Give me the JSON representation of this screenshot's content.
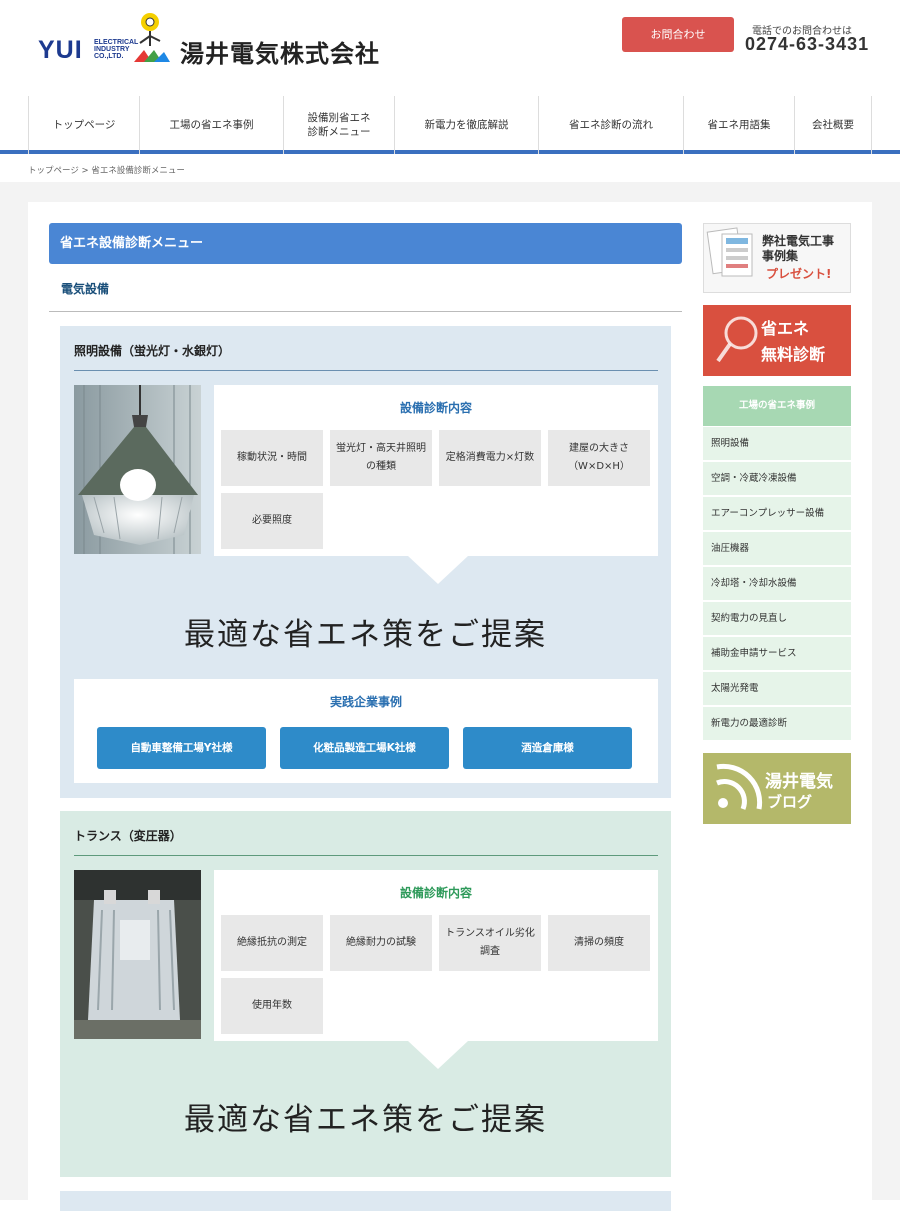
{
  "header": {
    "logo_text": "YUI",
    "logo_sub": "ELECTRICAL INDUSTRY CO.,LTD.",
    "company_name": "湯井電気株式会社",
    "contact_button": "お問合わせ",
    "tel_label": "電話でのお問合わせは",
    "tel_number": "0274-63-3431"
  },
  "nav": {
    "items": [
      {
        "label": "トップページ"
      },
      {
        "label": "工場の省エネ事例"
      },
      {
        "label": "設備別省エネ\n診断メニュー"
      },
      {
        "label": "新電力を徹底解説"
      },
      {
        "label": "省エネ診断の流れ"
      },
      {
        "label": "省エネ用語集"
      },
      {
        "label": "会社概要"
      }
    ]
  },
  "breadcrumb": {
    "home": "トップページ",
    "sep": ">",
    "current": "省エネ設備診断メニュー"
  },
  "main": {
    "title": "省エネ設備診断メニュー",
    "subtitle": "電気設備",
    "sections": [
      {
        "heading": "照明設備（蛍光灯・水銀灯）",
        "diag_heading": "設備診断内容",
        "items": [
          "稼動状況・時間",
          "蛍光灯・高天井照明の種類",
          "定格消費電力×灯数",
          "建屋の大きさ（W×D×H）",
          "必要照度"
        ],
        "proposal": "最適な省エネ策をご提案",
        "cases_heading": "実践企業事例",
        "cases": [
          "自動車整備工場Y社様",
          "化粧品製造工場K社様",
          "酒造倉庫様"
        ]
      },
      {
        "heading": "トランス（変圧器）",
        "diag_heading": "設備診断内容",
        "items": [
          "絶縁抵抗の測定",
          "絶縁耐力の試験",
          "トランスオイル劣化調査",
          "清掃の頻度",
          "使用年数"
        ],
        "proposal": "最適な省エネ策をご提案"
      }
    ]
  },
  "sidebar": {
    "banner1_lines": [
      "弊社電気工事",
      "事例集",
      "プレゼント!"
    ],
    "banner2_lines": [
      "省エネ",
      "無料診断"
    ],
    "menu_heading": "工場の省エネ事例",
    "menu_items": [
      "照明設備",
      "空調・冷蔵冷凍設備",
      "エアーコンプレッサー設備",
      "油圧機器",
      "冷却塔・冷却水設備",
      "契約電力の見直し",
      "補助金申請サービス",
      "太陽光発電",
      "新電力の最適診断"
    ],
    "blog_lines": [
      "湯井電気",
      "ブログ"
    ]
  },
  "colors": {
    "accent_blue": "#4a86d4",
    "nav_border": "#3a6fbf",
    "contact_red": "#d9534f",
    "case_button": "#2e8bc9",
    "section1_bg": "#dde8f1",
    "section2_bg": "#d9ebe4",
    "side_green": "#a7d8b3",
    "blog_olive": "#b4b86a"
  }
}
